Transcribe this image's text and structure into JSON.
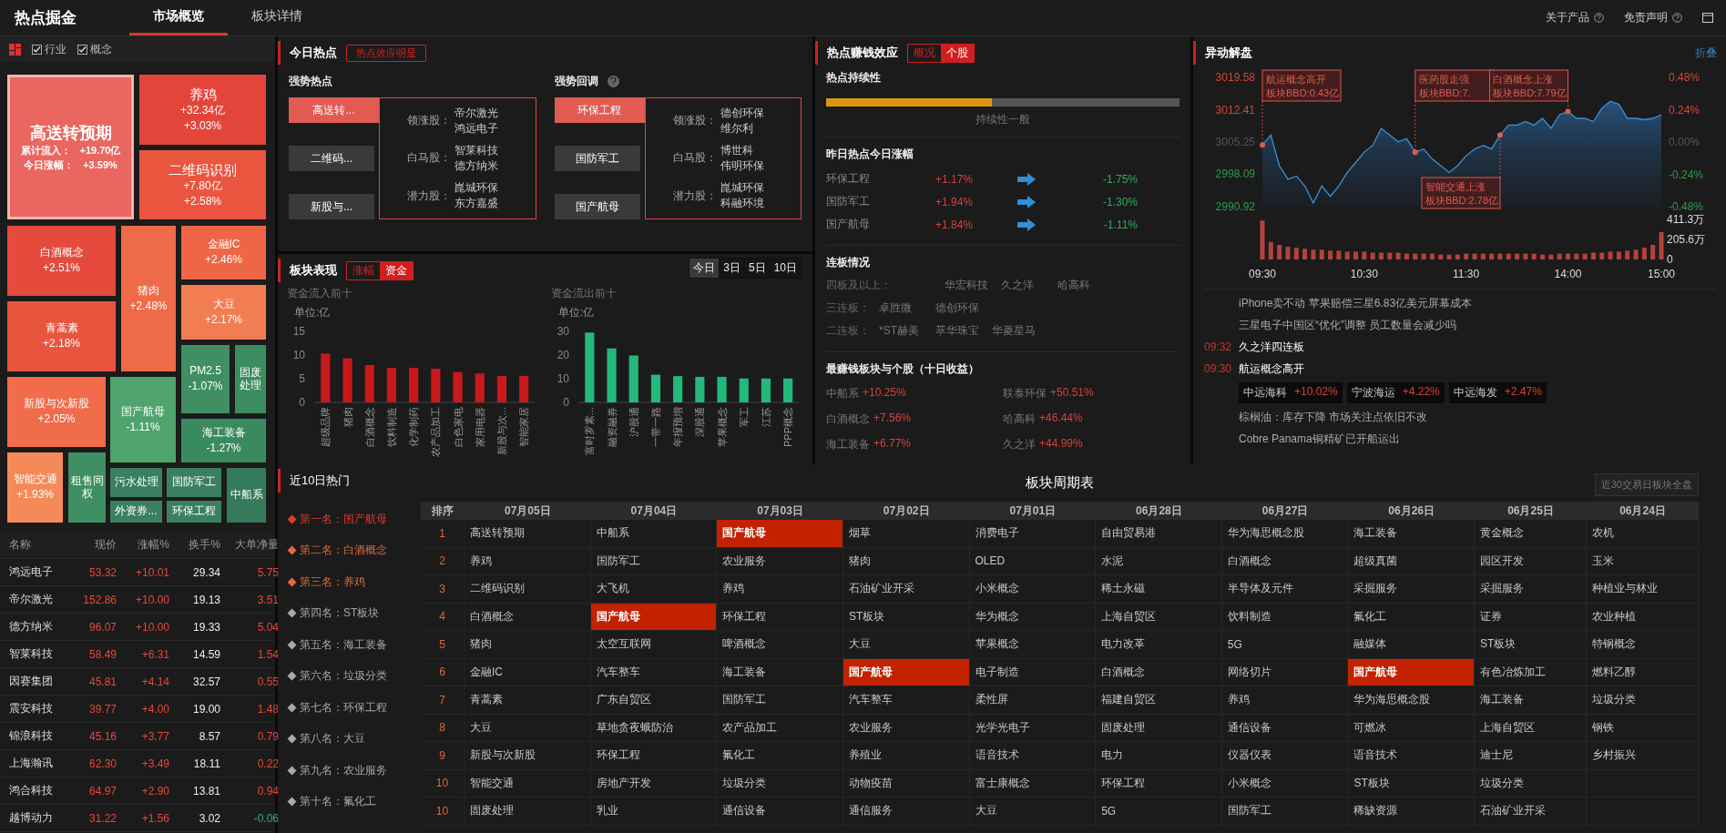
{
  "header": {
    "title": "热点掘金",
    "tabs": [
      {
        "label": "市场概览",
        "selected": true
      },
      {
        "label": "板块详情",
        "selected": false
      }
    ],
    "links": [
      "关于产品",
      "免责声明"
    ]
  },
  "filters": [
    {
      "label": "行业",
      "checked": true
    },
    {
      "label": "概念",
      "checked": true
    }
  ],
  "treemap": [
    {
      "kind": "detailed",
      "name": "高送转预期",
      "flow_label": "累计流入：",
      "flow": "+19.70亿",
      "change_label": "今日涨幅：",
      "change": "+3.59%",
      "color": "#ea6660",
      "selected": true
    },
    {
      "kind": "full",
      "name": "养鸡",
      "flow": "+32.34亿",
      "change": "+3.03%",
      "color": "#e4453a",
      "selected": false
    },
    {
      "kind": "full",
      "name": "二维码识别",
      "flow": "+7.80亿",
      "change": "+2.58%",
      "color": "#ea5540",
      "selected": false
    },
    {
      "kind": "basic",
      "name": "白酒概念",
      "change": "+2.51%",
      "color": "#e54a3c",
      "selected": false
    },
    {
      "kind": "basic",
      "name": "猪肉",
      "change": "+2.48%",
      "color": "#ef6a48",
      "selected": false
    },
    {
      "kind": "basic",
      "name": "金融IC",
      "change": "+2.46%",
      "color": "#ee6646",
      "selected": false
    },
    {
      "kind": "basic",
      "name": "大豆",
      "change": "+2.17%",
      "color": "#f27d52",
      "selected": false
    },
    {
      "kind": "basic",
      "name": "青蒿素",
      "change": "+2.18%",
      "color": "#e8553f",
      "selected": false
    },
    {
      "kind": "basic",
      "name": "PM2.5",
      "change": "-1.07%",
      "color": "#3f8f62",
      "selected": false
    },
    {
      "kind": "name",
      "name": "固废处理",
      "color": "#3b8c60",
      "selected": false
    },
    {
      "kind": "basic",
      "name": "新股与次新股",
      "change": "+2.05%",
      "color": "#f06c4a",
      "selected": false
    },
    {
      "kind": "basic",
      "name": "国产航母",
      "change": "-1.11%",
      "color": "#4fa36c",
      "selected": false
    },
    {
      "kind": "basic",
      "name": "海工装备",
      "change": "-1.27%",
      "color": "#3a8a60",
      "selected": false
    },
    {
      "kind": "basic",
      "name": "智能交通",
      "change": "+1.93%",
      "color": "#f58a58",
      "selected": false
    },
    {
      "kind": "name",
      "name": "租售同权",
      "color": "#3f8f62",
      "selected": false
    },
    {
      "kind": "name",
      "name": "污水处理",
      "color": "#3a8060",
      "selected": false
    },
    {
      "kind": "name",
      "name": "国防军工",
      "color": "#3a8060",
      "selected": false
    },
    {
      "kind": "name",
      "name": "中船系",
      "color": "#357a5a",
      "selected": false
    },
    {
      "kind": "name",
      "name": "外资券...",
      "color": "#3a8060",
      "selected": false
    },
    {
      "kind": "name",
      "name": "环保工程",
      "color": "#3a8060",
      "selected": false
    }
  ],
  "stock_table": {
    "columns": [
      "名称",
      "现价",
      "涨幅%",
      "换手%",
      "大单净量"
    ],
    "rows": [
      {
        "name": "鸿远电子",
        "price": "53.32",
        "change": "+10.01",
        "turnover": "29.34",
        "net": "5.75",
        "net_down": false
      },
      {
        "name": "帝尔激光",
        "price": "152.86",
        "change": "+10.00",
        "turnover": "19.13",
        "net": "3.51",
        "net_down": false
      },
      {
        "name": "德方纳米",
        "price": "96.07",
        "change": "+10.00",
        "turnover": "19.33",
        "net": "5.04",
        "net_down": false
      },
      {
        "name": "智莱科技",
        "price": "58.49",
        "change": "+6.31",
        "turnover": "14.59",
        "net": "1.54",
        "net_down": false
      },
      {
        "name": "因赛集团",
        "price": "45.81",
        "change": "+4.14",
        "turnover": "32.57",
        "net": "0.55",
        "net_down": false
      },
      {
        "name": "震安科技",
        "price": "39.77",
        "change": "+4.00",
        "turnover": "19.00",
        "net": "1.48",
        "net_down": false
      },
      {
        "name": "锦浪科技",
        "price": "45.16",
        "change": "+3.77",
        "turnover": "8.57",
        "net": "0.79",
        "net_down": false
      },
      {
        "name": "上海瀚讯",
        "price": "62.30",
        "change": "+3.49",
        "turnover": "18.11",
        "net": "0.22",
        "net_down": false
      },
      {
        "name": "鸿合科技",
        "price": "64.97",
        "change": "+2.90",
        "turnover": "13.81",
        "net": "0.94",
        "net_down": false
      },
      {
        "name": "越博动力",
        "price": "31.22",
        "change": "+1.56",
        "turnover": "3.02",
        "net": "-0.06",
        "net_down": true
      }
    ]
  },
  "today_hot": {
    "title": "今日热点",
    "badge": "热点效应明显",
    "groups": [
      {
        "title": "强势热点",
        "help": false,
        "sectors": [
          {
            "label": "高送转...",
            "selected": true
          },
          {
            "label": "二维码...",
            "selected": false
          },
          {
            "label": "新股与...",
            "selected": false
          }
        ],
        "details": [
          {
            "label": "领涨股：",
            "stocks": [
              "帝尔激光",
              "鸿远电子"
            ]
          },
          {
            "label": "白马股：",
            "stocks": [
              "智莱科技",
              "德方纳米"
            ]
          },
          {
            "label": "潜力股：",
            "stocks": [
              "崑城环保",
              "东方嘉盛"
            ]
          }
        ]
      },
      {
        "title": "强势回调",
        "help": true,
        "sectors": [
          {
            "label": "环保工程",
            "selected": true
          },
          {
            "label": "国防军工",
            "selected": false
          },
          {
            "label": "国产航母",
            "selected": false
          }
        ],
        "details": [
          {
            "label": "领涨股：",
            "stocks": [
              "德创环保",
              "维尔利"
            ]
          },
          {
            "label": "白马股：",
            "stocks": [
              "博世科",
              "伟明环保"
            ]
          },
          {
            "label": "潜力股：",
            "stocks": [
              "崑城环保",
              "科融环境"
            ]
          }
        ]
      }
    ]
  },
  "sector_perf": {
    "title": "板块表现",
    "modes": [
      {
        "label": "涨幅",
        "selected": false
      },
      {
        "label": "资金",
        "selected": true
      }
    ],
    "periods": [
      {
        "label": "今日",
        "selected": true
      },
      {
        "label": "3日",
        "selected": false
      },
      {
        "label": "5日",
        "selected": false
      },
      {
        "label": "10日",
        "selected": false
      }
    ],
    "charts": [
      {
        "heading": "资金流入前十",
        "unit": "单位:亿",
        "chart_data": {
          "type": "bar",
          "categories": [
            "超级品牌",
            "猪肉",
            "白酒概念",
            "饮料制造",
            "化学制药",
            "农产品加工",
            "白色家电",
            "家用电器",
            "新股与次...",
            "智能家居"
          ],
          "series": [
            {
              "color": "#c8191a",
              "values": [
                10.3,
                9.3,
                7.9,
                7.3,
                7.3,
                7.1,
                6.4,
                6.1,
                5.6,
                5.6
              ]
            }
          ],
          "ylim": [
            0,
            15
          ],
          "yticks": [
            0,
            5,
            10,
            15
          ]
        }
      },
      {
        "heading": "资金流出前十",
        "unit": "单位:亿",
        "chart_data": {
          "type": "bar",
          "categories": [
            "富时罗素...",
            "融资融券",
            "沪股通",
            "一带一路",
            "年报预增",
            "深股通",
            "苹果概念",
            "军工",
            "江苏",
            "PPP概念"
          ],
          "series": [
            {
              "color": "#23b97a",
              "values": [
                29.5,
                22.8,
                19.8,
                11.7,
                11.1,
                10.8,
                10.8,
                10.1,
                10.1,
                10.1
              ]
            }
          ],
          "ylim": [
            0,
            30
          ],
          "yticks": [
            0,
            10,
            20,
            30
          ]
        }
      }
    ]
  },
  "money_effect": {
    "title": "热点赚钱效应",
    "modes": [
      {
        "label": "概况",
        "selected": false
      },
      {
        "label": "个股",
        "selected": true
      }
    ],
    "continuity": {
      "heading": "热点持续性",
      "level": 0.47,
      "caption": "持续性一般"
    },
    "yesterday": {
      "heading": "昨日热点今日涨幅",
      "rows": [
        {
          "name": "环保工程",
          "yesterday": "+1.17%",
          "today": "-1.75%"
        },
        {
          "name": "国防军工",
          "yesterday": "+1.94%",
          "today": "-1.30%"
        },
        {
          "name": "国产航母",
          "yesterday": "+1.84%",
          "today": "-1.11%"
        }
      ]
    },
    "streaks": {
      "heading": "连板情况",
      "rows": [
        {
          "label": "四板及以上：",
          "stocks": [
            "华宏科技",
            "久之洋",
            "哈高科"
          ]
        },
        {
          "label": "三连板：",
          "stocks": [
            "卓胜微",
            "德创环保"
          ]
        },
        {
          "label": "二连板：",
          "stocks": [
            "*ST赫美",
            "萃华珠宝",
            "华菱星马"
          ]
        }
      ]
    },
    "top": {
      "heading": "最赚钱板块与个股（十日收益）",
      "sectors": [
        {
          "name": "中船系",
          "gain": "+10.25%"
        },
        {
          "name": "白酒概念",
          "gain": "+7.56%"
        },
        {
          "name": "海工装备",
          "gain": "+6.77%"
        }
      ],
      "stocks": [
        {
          "name": "联泰环保",
          "gain": "+50.51%"
        },
        {
          "name": "哈高科",
          "gain": "+46.44%"
        },
        {
          "name": "久之洋",
          "gain": "+44.99%"
        }
      ]
    }
  },
  "intraday": {
    "title": "异动解盘",
    "fold": "折叠",
    "chart_data": {
      "type": "area",
      "categories": [
        null,
        null,
        null,
        null,
        null,
        null,
        null,
        null,
        null,
        null,
        null,
        null,
        null,
        null,
        null,
        null,
        null,
        null,
        null,
        null,
        null,
        null,
        null,
        null,
        null,
        null,
        null,
        null,
        null,
        null,
        null,
        null,
        null,
        null,
        null,
        null,
        null,
        null,
        null,
        null,
        null,
        null,
        null,
        null,
        null,
        null,
        null,
        null
      ],
      "series": [
        {
          "color": "#3c8fd6",
          "values": [
            3004.6,
            3006.8,
            3000.0,
            2997.0,
            2997.7,
            2995.5,
            2991.7,
            2995.5,
            2993.2,
            2995.5,
            2998.5,
            3000.7,
            3003.0,
            3004.5,
            3008.3,
            3006.8,
            3005.3,
            3006.0,
            3003.0,
            3003.7,
            3001.5,
            3000.0,
            2998.5,
            3000.0,
            3002.2,
            3003.7,
            3004.5,
            3003.7,
            3006.8,
            3009.0,
            3009.0,
            3009.8,
            3009.0,
            3010.5,
            3008.3,
            3011.3,
            3012.0,
            3010.5,
            3010.5,
            3009.8,
            3012.8,
            3014.3,
            3013.6,
            3010.5,
            3010.5,
            3010.2,
            3010.5,
            3011.3
          ]
        }
      ],
      "ylim": [
        2990.92,
        3019.58
      ],
      "yticks": [
        {
          "value": 2990.92,
          "label": "2990.92"
        },
        {
          "value": 2998.09,
          "label": "2998.09"
        },
        {
          "value": 3005.25,
          "label": "3005.25"
        },
        {
          "value": 3012.41,
          "label": "3012.41"
        },
        {
          "value": 3019.58,
          "label": "3019.58"
        }
      ],
      "annotations": [
        "航运概念高开",
        "医药股走强",
        "智能交通上涨",
        "白酒概念上涨"
      ]
    },
    "callouts": [
      {
        "detail": "板块BBD:0.43亿"
      },
      {
        "detail": "板块BBD:7."
      },
      {
        "detail": "板块BBD:2.78亿"
      },
      {
        "detail": "板块BBD:7.79亿"
      }
    ],
    "right_axis": [
      "0.48%",
      "0.24%",
      "0.00%",
      "-0.24%",
      "-0.48%"
    ],
    "volume": {
      "chart_data": {
        "type": "bar",
        "categories": [
          "09:30",
          null,
          null,
          null,
          null,
          null,
          null,
          null,
          null,
          null,
          null,
          null,
          "10:30",
          null,
          null,
          null,
          null,
          null,
          null,
          null,
          null,
          null,
          null,
          null,
          "11:30",
          null,
          null,
          null,
          null,
          null,
          null,
          null,
          null,
          null,
          null,
          null,
          "14:00",
          null,
          null,
          null,
          null,
          null,
          null,
          null,
          null,
          null,
          null,
          "15:00"
        ],
        "series": [
          {
            "color": "#b3423c",
            "values": [
              400,
              180,
              150,
              130,
              120,
              110,
              100,
              100,
              90,
              90,
              80,
              80,
              80,
              70,
              70,
              70,
              70,
              60,
              60,
              60,
              60,
              50,
              50,
              50,
              60,
              60,
              60,
              60,
              60,
              60,
              60,
              60,
              60,
              50,
              50,
              60,
              60,
              60,
              60,
              70,
              70,
              80,
              80,
              90,
              100,
              120,
              150,
              280
            ]
          }
        ],
        "ylim": [
          0,
          411.3
        ],
        "yticks": [
          {
            "value": 0,
            "label": "0"
          },
          {
            "value": 205.6,
            "label": "205.6万"
          },
          {
            "value": 411.3,
            "label": "411.3万"
          }
        ]
      }
    },
    "news": [
      {
        "kind": "headline",
        "title": "iPhone卖不动 苹果赔偿三星6.83亿美元屏幕成本"
      },
      {
        "kind": "headline",
        "title": "三星电子中国区“优化”调整 员工数量会减少吗"
      },
      {
        "kind": "event",
        "time": "09:32",
        "title": "久之洋四连板"
      },
      {
        "kind": "event",
        "time": "09:30",
        "title": "航运概念高开",
        "stocks": [
          {
            "name": "中远海科",
            "change": "+10.02%"
          },
          {
            "name": "宁波海运",
            "change": "+4.22%"
          },
          {
            "name": "中远海发",
            "change": "+2.47%"
          }
        ]
      },
      {
        "kind": "headline",
        "title": "棕榈油：库存下降 市场关注点依旧不改"
      },
      {
        "kind": "headline",
        "title": "Cobre Panama铜精矿已开船运出"
      }
    ]
  },
  "hot10": {
    "title": "近10日热门",
    "items": [
      {
        "label": "第一名：国产航母",
        "color": "#e23a2a"
      },
      {
        "label": "第二名：白酒概念",
        "color": "#e06a3a"
      },
      {
        "label": "第三名：养鸡",
        "color": "#e06a3a"
      },
      {
        "label": "第四名：ST板块",
        "color": "#a8a8a8"
      },
      {
        "label": "第五名：海工装备",
        "color": "#a8a8a8"
      },
      {
        "label": "第六名：垃圾分类",
        "color": "#a8a8a8"
      },
      {
        "label": "第七名：环保工程",
        "color": "#a8a8a8"
      },
      {
        "label": "第八名：大豆",
        "color": "#a8a8a8"
      },
      {
        "label": "第九名：农业服务",
        "color": "#a8a8a8"
      },
      {
        "label": "第十名：氟化工",
        "color": "#a8a8a8"
      }
    ]
  },
  "cycle_table": {
    "title": "板块周期表",
    "button": "近30交易日板块全盘",
    "columns": [
      "排序",
      "07月05日",
      "07月04日",
      "07月03日",
      "07月02日",
      "07月01日",
      "06月28日",
      "06月27日",
      "06月26日",
      "06月25日",
      "06月24日"
    ],
    "rows": [
      {
        "rank": "1",
        "cells": [
          {
            "text": "高送转预期",
            "highlighted": false
          },
          {
            "text": "中船系",
            "highlighted": false
          },
          {
            "text": "国产航母",
            "highlighted": true
          },
          {
            "text": "烟草",
            "highlighted": false
          },
          {
            "text": "消费电子",
            "highlighted": false
          },
          {
            "text": "自由贸易港",
            "highlighted": false
          },
          {
            "text": "华为海思概念股",
            "highlighted": false
          },
          {
            "text": "海工装备",
            "highlighted": false
          },
          {
            "text": "黄金概念",
            "highlighted": false
          },
          {
            "text": "农机",
            "highlighted": false
          }
        ]
      },
      {
        "rank": "2",
        "cells": [
          {
            "text": "养鸡",
            "highlighted": false
          },
          {
            "text": "国防军工",
            "highlighted": false
          },
          {
            "text": "农业服务",
            "highlighted": false
          },
          {
            "text": "猪肉",
            "highlighted": false
          },
          {
            "text": "OLED",
            "highlighted": false
          },
          {
            "text": "水泥",
            "highlighted": false
          },
          {
            "text": "白酒概念",
            "highlighted": false
          },
          {
            "text": "超级真菌",
            "highlighted": false
          },
          {
            "text": "园区开发",
            "highlighted": false
          },
          {
            "text": "玉米",
            "highlighted": false
          }
        ]
      },
      {
        "rank": "3",
        "cells": [
          {
            "text": "二维码识别",
            "highlighted": false
          },
          {
            "text": "大飞机",
            "highlighted": false
          },
          {
            "text": "养鸡",
            "highlighted": false
          },
          {
            "text": "石油矿业开采",
            "highlighted": false
          },
          {
            "text": "小米概念",
            "highlighted": false
          },
          {
            "text": "稀土永磁",
            "highlighted": false
          },
          {
            "text": "半导体及元件",
            "highlighted": false
          },
          {
            "text": "采掘服务",
            "highlighted": false
          },
          {
            "text": "采掘服务",
            "highlighted": false
          },
          {
            "text": "种植业与林业",
            "highlighted": false
          }
        ]
      },
      {
        "rank": "4",
        "cells": [
          {
            "text": "白酒概念",
            "highlighted": false
          },
          {
            "text": "国产航母",
            "highlighted": true
          },
          {
            "text": "环保工程",
            "highlighted": false
          },
          {
            "text": "ST板块",
            "highlighted": false
          },
          {
            "text": "华为概念",
            "highlighted": false
          },
          {
            "text": "上海自贸区",
            "highlighted": false
          },
          {
            "text": "饮料制造",
            "highlighted": false
          },
          {
            "text": "氟化工",
            "highlighted": false
          },
          {
            "text": "证券",
            "highlighted": false
          },
          {
            "text": "农业种植",
            "highlighted": false
          }
        ]
      },
      {
        "rank": "5",
        "cells": [
          {
            "text": "猪肉",
            "highlighted": false
          },
          {
            "text": "太空互联网",
            "highlighted": false
          },
          {
            "text": "啤酒概念",
            "highlighted": false
          },
          {
            "text": "大豆",
            "highlighted": false
          },
          {
            "text": "苹果概念",
            "highlighted": false
          },
          {
            "text": "电力改革",
            "highlighted": false
          },
          {
            "text": "5G",
            "highlighted": false
          },
          {
            "text": "融媒体",
            "highlighted": false
          },
          {
            "text": "ST板块",
            "highlighted": false
          },
          {
            "text": "特钢概念",
            "highlighted": false
          }
        ]
      },
      {
        "rank": "6",
        "cells": [
          {
            "text": "金融IC",
            "highlighted": false
          },
          {
            "text": "汽车整车",
            "highlighted": false
          },
          {
            "text": "海工装备",
            "highlighted": false
          },
          {
            "text": "国产航母",
            "highlighted": true
          },
          {
            "text": "电子制造",
            "highlighted": false
          },
          {
            "text": "白酒概念",
            "highlighted": false
          },
          {
            "text": "网络切片",
            "highlighted": false
          },
          {
            "text": "国产航母",
            "highlighted": true
          },
          {
            "text": "有色冶炼加工",
            "highlighted": false
          },
          {
            "text": "燃料乙醇",
            "highlighted": false
          }
        ]
      },
      {
        "rank": "7",
        "cells": [
          {
            "text": "青蒿素",
            "highlighted": false
          },
          {
            "text": "广东自贸区",
            "highlighted": false
          },
          {
            "text": "国防军工",
            "highlighted": false
          },
          {
            "text": "汽车整车",
            "highlighted": false
          },
          {
            "text": "柔性屏",
            "highlighted": false
          },
          {
            "text": "福建自贸区",
            "highlighted": false
          },
          {
            "text": "养鸡",
            "highlighted": false
          },
          {
            "text": "华为海思概念股",
            "highlighted": false
          },
          {
            "text": "海工装备",
            "highlighted": false
          },
          {
            "text": "垃圾分类",
            "highlighted": false
          }
        ]
      },
      {
        "rank": "8",
        "cells": [
          {
            "text": "大豆",
            "highlighted": false
          },
          {
            "text": "草地贪夜蛾防治",
            "highlighted": false
          },
          {
            "text": "农产品加工",
            "highlighted": false
          },
          {
            "text": "农业服务",
            "highlighted": false
          },
          {
            "text": "光学光电子",
            "highlighted": false
          },
          {
            "text": "固废处理",
            "highlighted": false
          },
          {
            "text": "通信设备",
            "highlighted": false
          },
          {
            "text": "可燃冰",
            "highlighted": false
          },
          {
            "text": "上海自贸区",
            "highlighted": false
          },
          {
            "text": "钢铁",
            "highlighted": false
          }
        ]
      },
      {
        "rank": "9",
        "cells": [
          {
            "text": "新股与次新股",
            "highlighted": false
          },
          {
            "text": "环保工程",
            "highlighted": false
          },
          {
            "text": "氟化工",
            "highlighted": false
          },
          {
            "text": "养殖业",
            "highlighted": false
          },
          {
            "text": "语音技术",
            "highlighted": false
          },
          {
            "text": "电力",
            "highlighted": false
          },
          {
            "text": "仪器仪表",
            "highlighted": false
          },
          {
            "text": "语音技术",
            "highlighted": false
          },
          {
            "text": "迪士尼",
            "highlighted": false
          },
          {
            "text": "乡村振兴",
            "highlighted": false
          }
        ]
      },
      {
        "rank": "10",
        "cells": [
          {
            "text": "智能交通",
            "highlighted": false
          },
          {
            "text": "房地产开发",
            "highlighted": false
          },
          {
            "text": "垃圾分类",
            "highlighted": false
          },
          {
            "text": "动物疫苗",
            "highlighted": false
          },
          {
            "text": "富士康概念",
            "highlighted": false
          },
          {
            "text": "环保工程",
            "highlighted": false
          },
          {
            "text": "小米概念",
            "highlighted": false
          },
          {
            "text": "ST板块",
            "highlighted": false
          },
          {
            "text": "垃圾分类",
            "highlighted": false
          },
          null
        ]
      },
      {
        "rank": "10",
        "cells": [
          {
            "text": "固废处理",
            "highlighted": false
          },
          {
            "text": "乳业",
            "highlighted": false
          },
          {
            "text": "通信设备",
            "highlighted": false
          },
          {
            "text": "通信服务",
            "highlighted": false
          },
          {
            "text": "大豆",
            "highlighted": false
          },
          {
            "text": "5G",
            "highlighted": false
          },
          {
            "text": "国防军工",
            "highlighted": false
          },
          {
            "text": "稀缺资源",
            "highlighted": false
          },
          {
            "text": "石油矿业开采",
            "highlighted": false
          },
          null
        ]
      }
    ]
  }
}
